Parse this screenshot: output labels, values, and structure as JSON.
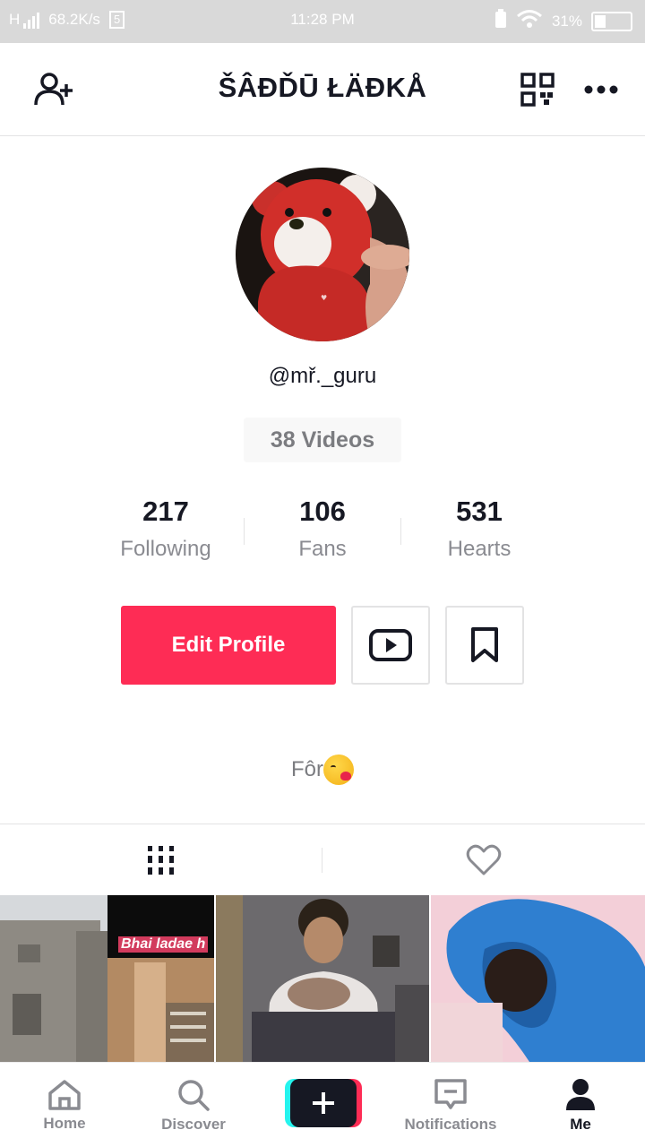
{
  "status_bar": {
    "network": "H",
    "speed": "68.2K/s",
    "sim_badge": "5",
    "time": "11:28 PM",
    "battery_percent": "31%",
    "battery_level": 0.31
  },
  "header": {
    "title": "ŠÂĐĎŪ ŁÄĐKÅ"
  },
  "profile": {
    "username": "@mř._guru",
    "videos_label": "38 Videos",
    "stats": [
      {
        "value": "217",
        "label": "Following"
      },
      {
        "value": "106",
        "label": "Fans"
      },
      {
        "value": "531",
        "label": "Hearts"
      }
    ],
    "edit_button": "Edit Profile",
    "bio": "Fôr"
  },
  "grid": {
    "thumb_caption": "Bhai ladae h"
  },
  "bottom_nav": {
    "items": [
      {
        "label": "Home",
        "icon": "home-icon"
      },
      {
        "label": "Discover",
        "icon": "search-icon"
      },
      {
        "label": "Notifications",
        "icon": "message-icon"
      },
      {
        "label": "Me",
        "icon": "person-icon"
      }
    ]
  },
  "colors": {
    "accent": "#fe2c55",
    "cyan": "#25f4ee",
    "text_dark": "#161823",
    "text_muted": "#8a8b91"
  }
}
